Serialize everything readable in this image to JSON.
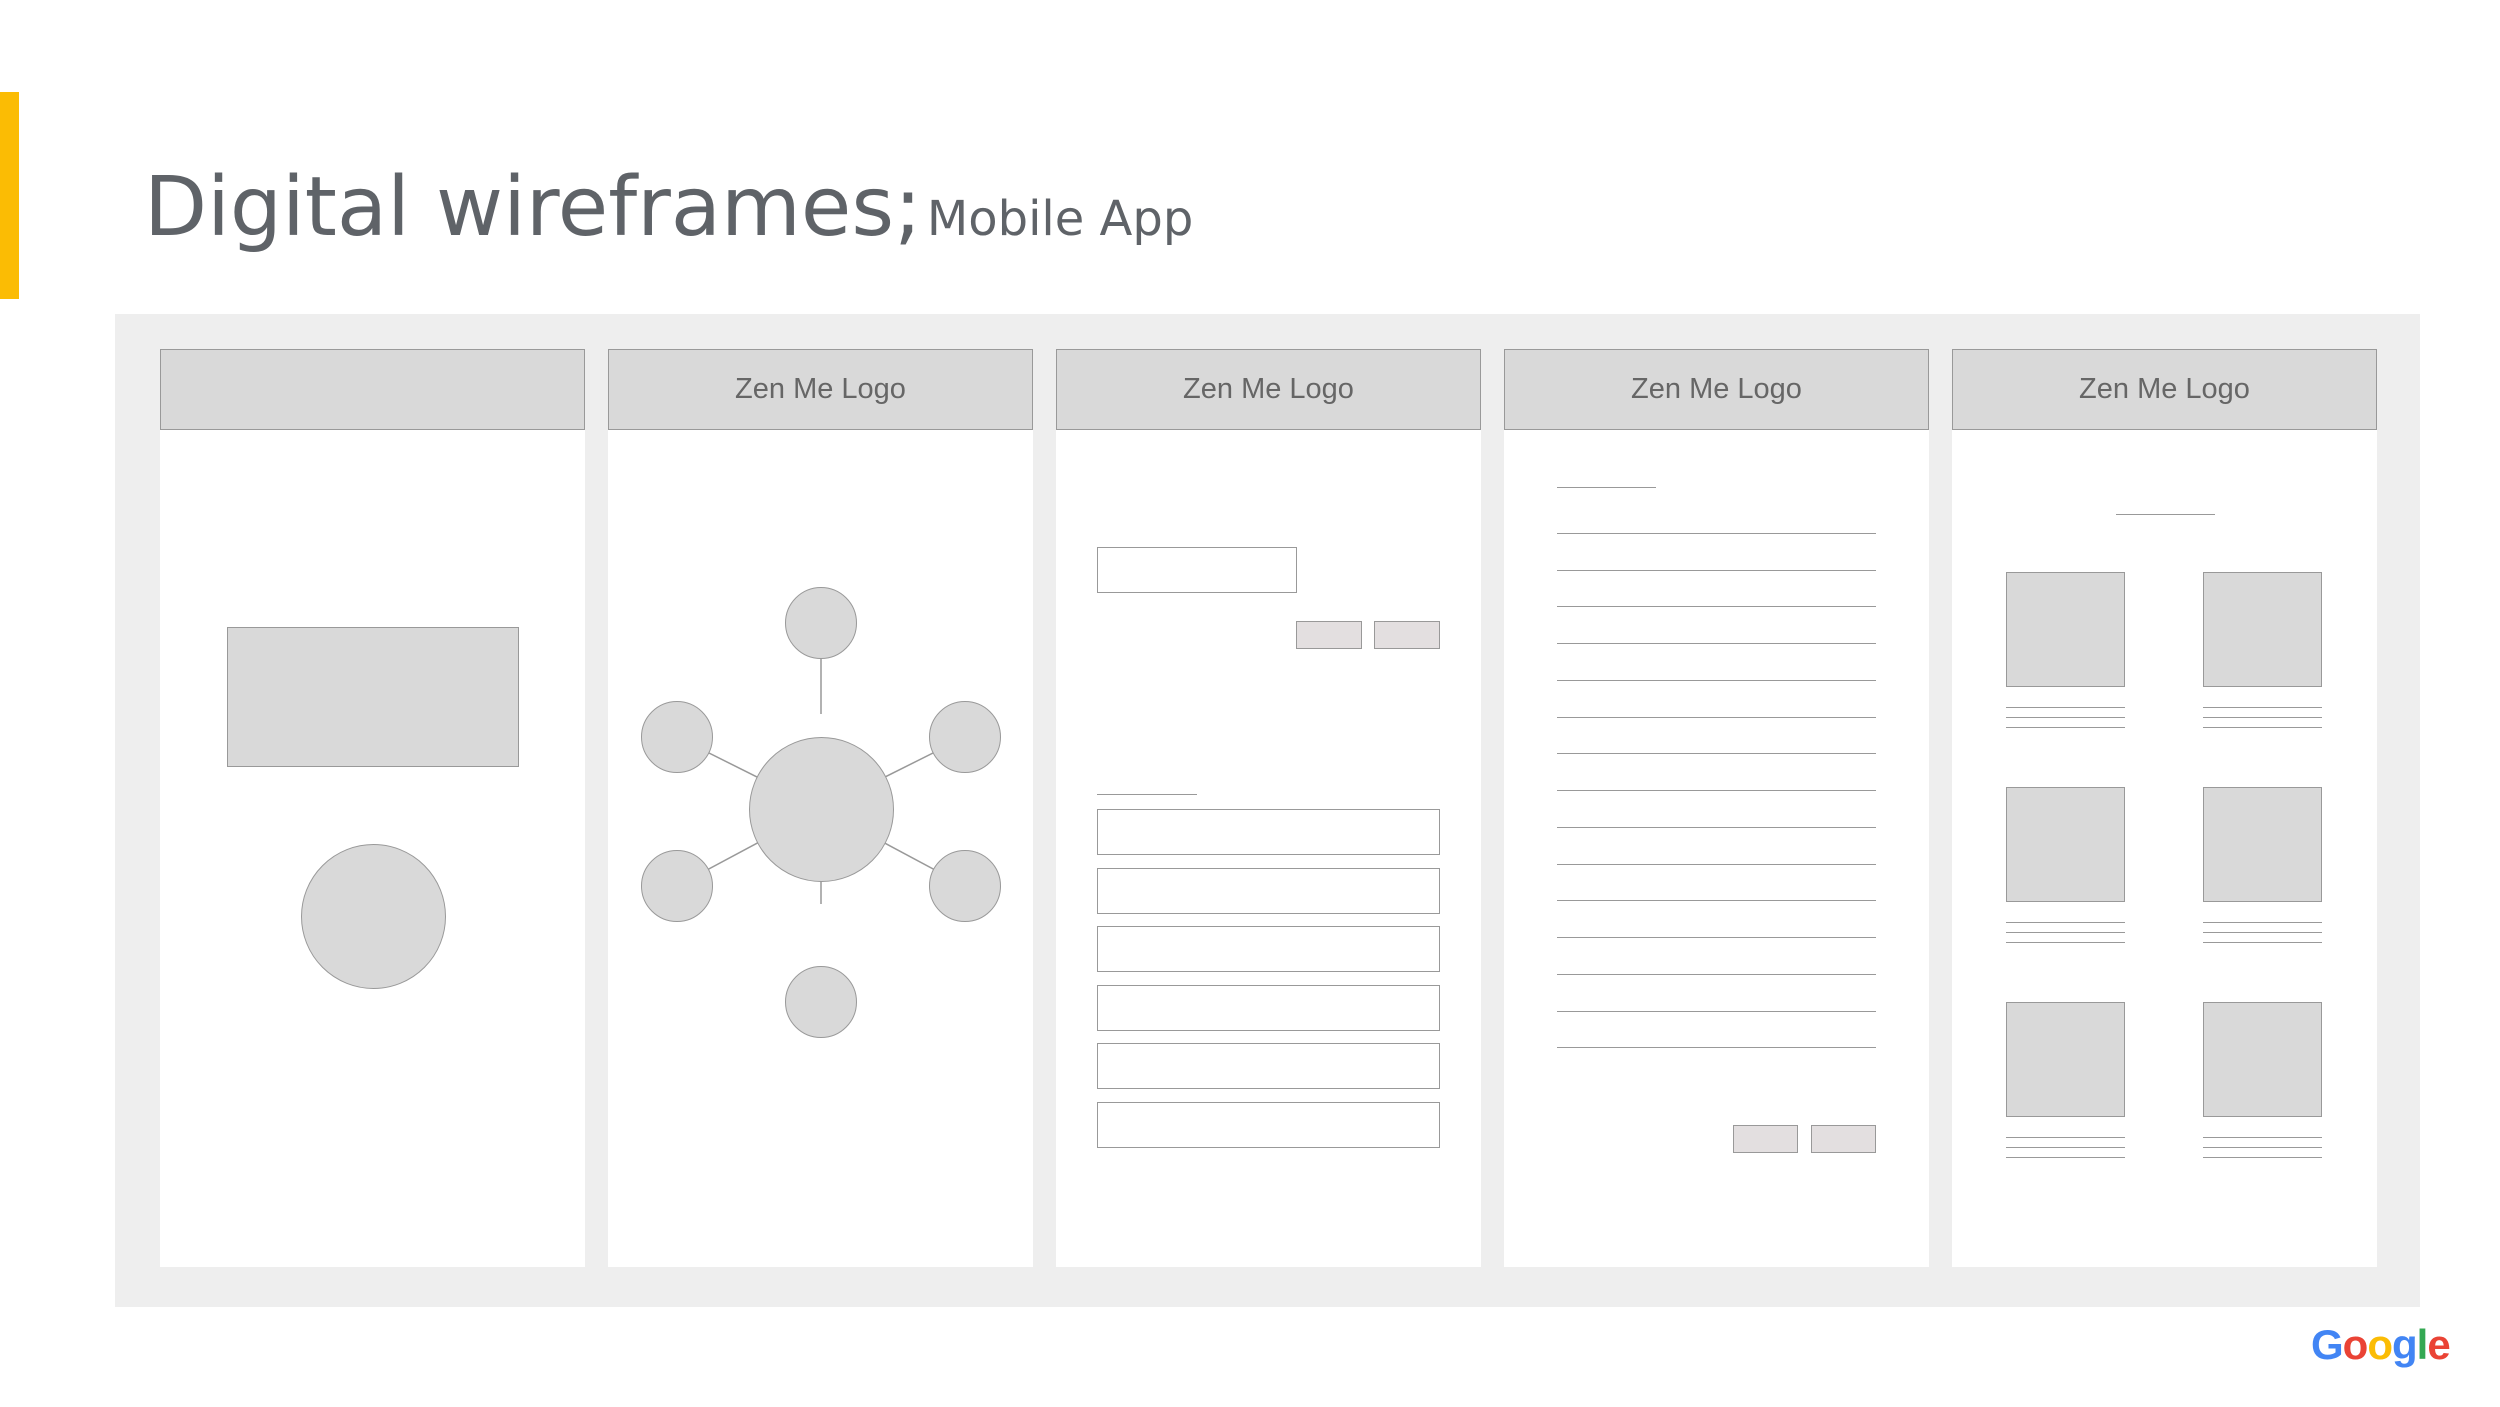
{
  "slide": {
    "title": "Digital wireframes;",
    "subtitle": "Mobile App",
    "accent_color": "#fbbc04"
  },
  "wireframes": {
    "screen2_header": "Zen Me Logo",
    "screen3_header": "Zen Me Logo",
    "screen4_header": "Zen Me Logo",
    "screen5_header": "Zen Me Logo"
  },
  "branding": {
    "logo_letters": [
      "G",
      "o",
      "o",
      "g",
      "l",
      "e"
    ],
    "logo_colors": [
      "#4285f4",
      "#ea4335",
      "#fbbc05",
      "#4285f4",
      "#34a853",
      "#ea4335"
    ]
  }
}
